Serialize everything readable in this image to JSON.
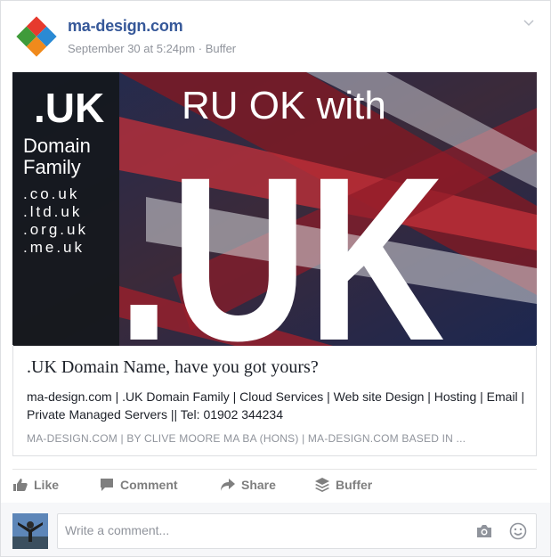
{
  "post": {
    "page_name": "ma-design.com",
    "timestamp": "September 30 at 5:24pm",
    "separator": "·",
    "via": "Buffer"
  },
  "hero": {
    "badge": ".UK",
    "family_line1": "Domain",
    "family_line2": "Family",
    "ext": [
      ".co.uk",
      ".ltd.uk",
      ".org.uk",
      ".me.uk"
    ],
    "headline": "RU OK with",
    "big": ".UK"
  },
  "link": {
    "title": ".UK Domain Name, have you got yours?",
    "description": "ma-design.com | .UK Domain Family | Cloud Services | Web site Design | Hosting | Email | Private Managed Servers || Tel: 01902 344234",
    "domain": "MA-DESIGN.COM | BY CLIVE MOORE MA BA (HONS) | MA-DESIGN.COM BASED IN ..."
  },
  "actions": {
    "like": "Like",
    "comment": "Comment",
    "share": "Share",
    "buffer": "Buffer"
  },
  "comment_box": {
    "placeholder": "Write a comment..."
  },
  "colors": {
    "link_blue": "#365899",
    "meta_grey": "#90949c",
    "action_grey": "#7f7f7f"
  }
}
